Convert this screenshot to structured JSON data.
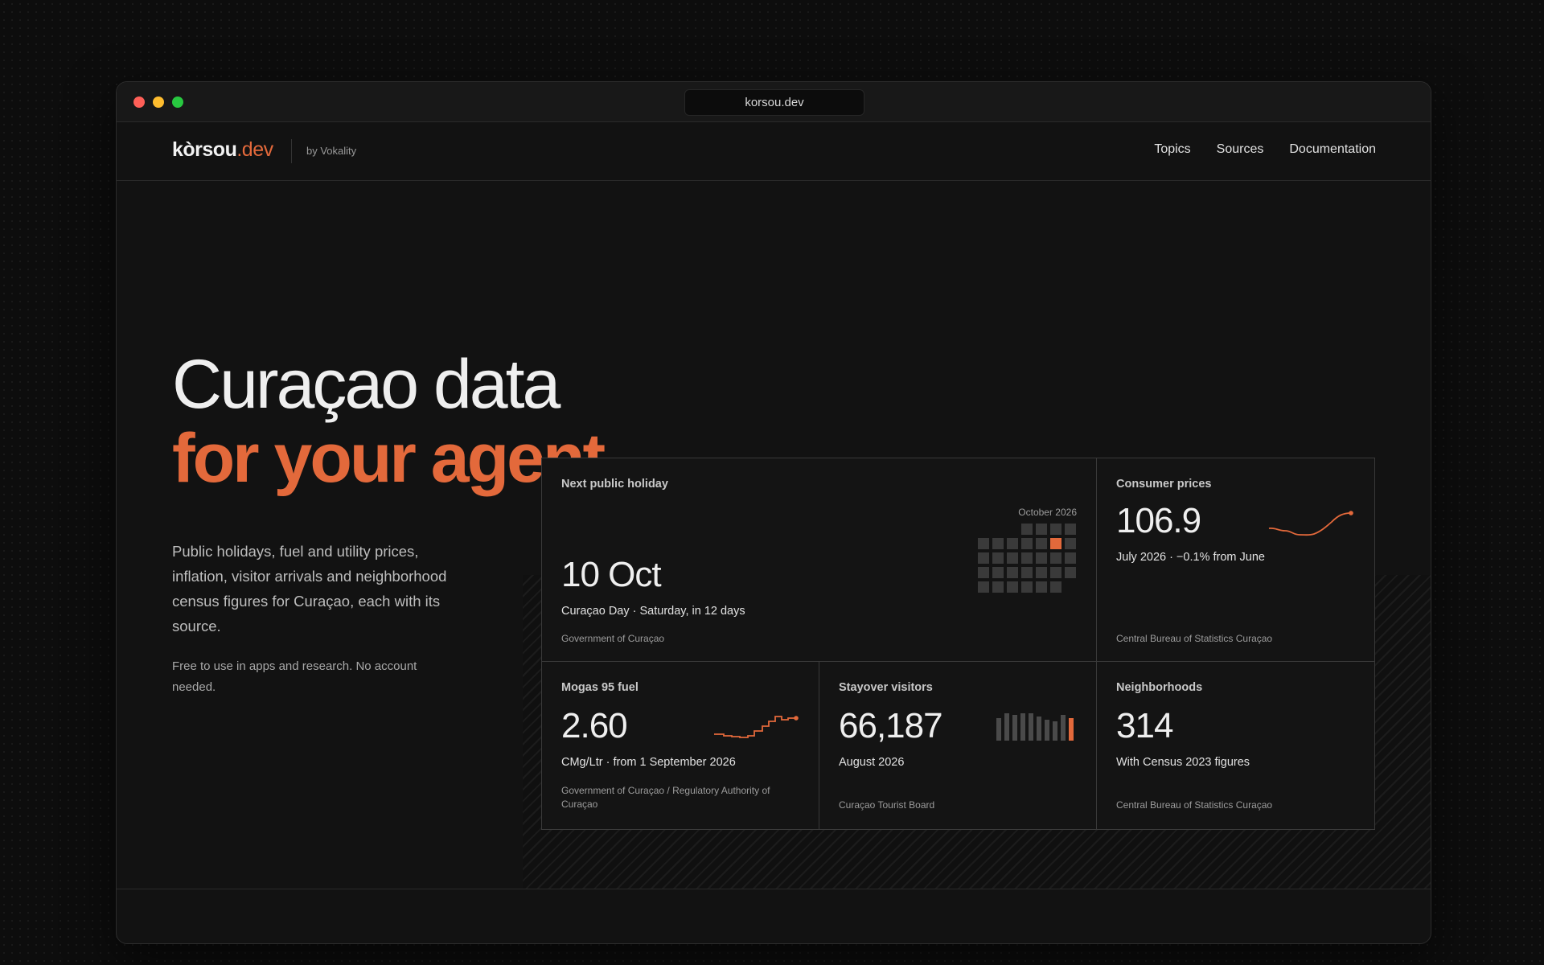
{
  "browser": {
    "url": "korsou.dev"
  },
  "nav": {
    "logo_name": "kòrsou",
    "logo_tld": ".dev",
    "byline": "by Vokality",
    "links": [
      "Topics",
      "Sources",
      "Documentation"
    ]
  },
  "hero": {
    "line1": "Curaçao data",
    "line2": "for your agent.",
    "description": "Public holidays, fuel and utility prices, inflation, visitor arrivals and neighborhood census figures for Curaçao, each with its source.",
    "note": "Free to use in apps and research. No account needed."
  },
  "colors": {
    "accent": "#e3693b",
    "background": "#121212",
    "cell_inactive": "#3a3a3a"
  },
  "cards": {
    "holiday": {
      "label": "Next public holiday",
      "value": "10 Oct",
      "detail": "Curaçao Day · Saturday, in 12 days",
      "source": "Government of Curaçao",
      "calendar_month": "October 2026",
      "calendar_days": 31,
      "calendar_start_weekday": 3,
      "highlight_day": 10
    },
    "cpi": {
      "label": "Consumer prices",
      "value": "106.9",
      "detail": "July 2026 · −0.1% from June",
      "source": "Central Bureau of Statistics Curaçao"
    },
    "fuel": {
      "label": "Mogas 95 fuel",
      "value": "2.60",
      "detail": "CMg/Ltr · from 1 September 2026",
      "source": "Government of Curaçao / Regulatory Authority of Curaçao"
    },
    "visitors": {
      "label": "Stayover visitors",
      "value": "66,187",
      "detail": "August 2026",
      "source": "Curaçao Tourist Board"
    },
    "neighborhoods": {
      "label": "Neighborhoods",
      "value": "314",
      "detail": "With Census 2023 figures",
      "source": "Central Bureau of Statistics Curaçao"
    }
  }
}
